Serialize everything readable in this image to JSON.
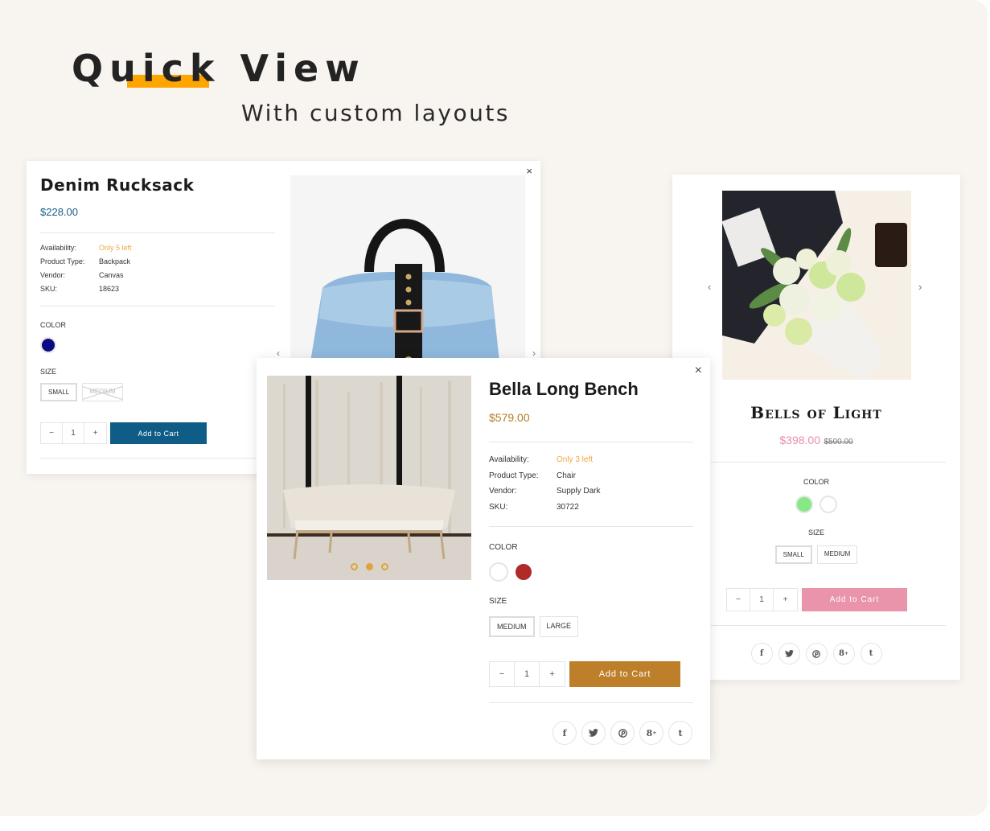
{
  "hero": {
    "title": "Quick View",
    "subtitle": "With custom layouts",
    "accent_color": "#ffa500"
  },
  "cards": {
    "rucksack": {
      "title": "Denim Rucksack",
      "price": "$228.00",
      "price_color": "#1a5e86",
      "meta": [
        {
          "label": "Availability:",
          "value": "Only 5 left",
          "highlight": true
        },
        {
          "label": "Product Type:",
          "value": "Backpack"
        },
        {
          "label": "Vendor:",
          "value": "Canvas"
        },
        {
          "label": "SKU:",
          "value": "18623"
        }
      ],
      "color_label": "COLOR",
      "colors": [
        {
          "name": "navy",
          "hex": "#0a0a82"
        }
      ],
      "size_label": "SIZE",
      "sizes": [
        {
          "label": "SMALL",
          "state": "selected"
        },
        {
          "label": "MEDIUM",
          "state": "disabled"
        }
      ],
      "quantity": "1",
      "qty_minus": "−",
      "qty_plus": "+",
      "add_to_cart": "Add to Cart",
      "button_color": "#0f5d86",
      "close_icon": "×",
      "prev_icon": "‹",
      "next_icon": "›",
      "image_alt": "Denim backpack with black leather strap"
    },
    "bench": {
      "title": "Bella Long Bench",
      "price": "$579.00",
      "price_color": "#b57d24",
      "meta": [
        {
          "label": "Availability:",
          "value": "Only 3 left",
          "highlight": true
        },
        {
          "label": "Product Type:",
          "value": "Chair"
        },
        {
          "label": "Vendor:",
          "value": "Supply Dark"
        },
        {
          "label": "SKU:",
          "value": "30722"
        }
      ],
      "color_label": "COLOR",
      "colors": [
        {
          "name": "white",
          "hex": "#ffffff"
        },
        {
          "name": "red",
          "hex": "#b02a2a"
        }
      ],
      "size_label": "SIZE",
      "sizes": [
        {
          "label": "MEDIUM",
          "state": "selected"
        },
        {
          "label": "LARGE",
          "state": "normal"
        }
      ],
      "quantity": "1",
      "qty_minus": "−",
      "qty_plus": "+",
      "add_to_cart": "Add to Cart",
      "button_color": "#be7f2a",
      "close_icon": "×",
      "slider_dots": 3,
      "active_dot": 2,
      "social": [
        "f",
        "t",
        "p",
        "g+",
        "t"
      ],
      "image_alt": "Upholstered long bench in front of forest window"
    },
    "bells": {
      "title": "Bells of Light",
      "price": "$398.00",
      "compare_price": "$500.00",
      "price_color": "#e88fa8",
      "color_label": "COLOR",
      "colors": [
        {
          "name": "green",
          "hex": "#86e886"
        },
        {
          "name": "white",
          "hex": "#ffffff"
        }
      ],
      "size_label": "SIZE",
      "sizes": [
        {
          "label": "SMALL",
          "state": "selected"
        },
        {
          "label": "MEDIUM",
          "state": "normal"
        }
      ],
      "quantity": "1",
      "qty_minus": "−",
      "qty_plus": "+",
      "add_to_cart": "Add to Cart",
      "button_color": "#e994aa",
      "prev_icon": "‹",
      "next_icon": "›",
      "image_alt": "Green and white flower bouquet"
    }
  },
  "social_icons": [
    {
      "name": "facebook-icon",
      "glyph": "f"
    },
    {
      "name": "twitter-icon",
      "glyph": "🐦"
    },
    {
      "name": "pinterest-icon",
      "glyph": "℗"
    },
    {
      "name": "google-plus-icon",
      "glyph": "g⁺"
    },
    {
      "name": "tumblr-icon",
      "glyph": "t"
    }
  ]
}
